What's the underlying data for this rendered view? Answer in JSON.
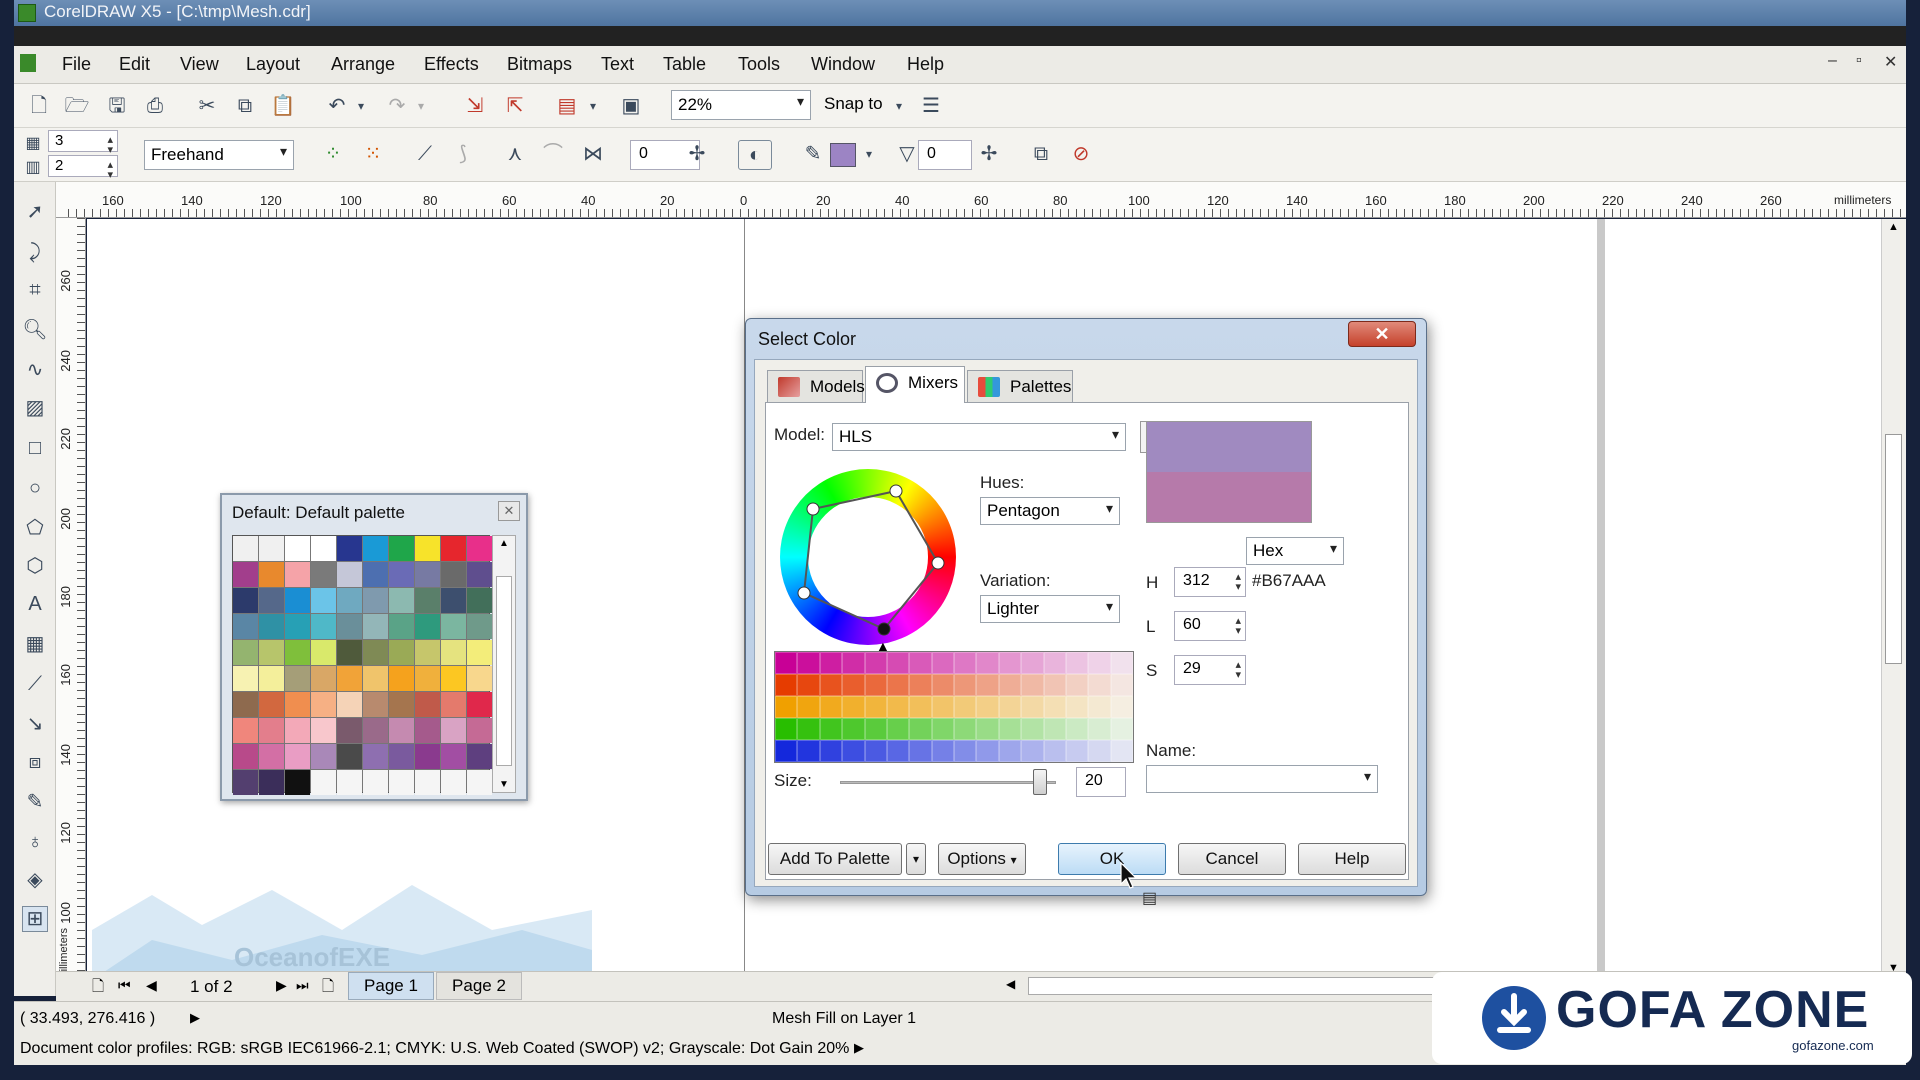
{
  "window": {
    "title": "CorelDRAW X5 - [C:\\tmp\\Mesh.cdr]"
  },
  "menu": [
    "File",
    "Edit",
    "View",
    "Layout",
    "Arrange",
    "Effects",
    "Bitmaps",
    "Text",
    "Table",
    "Tools",
    "Window",
    "Help"
  ],
  "toolbar": {
    "zoom": "22%",
    "snap_to": "Snap to"
  },
  "propbar": {
    "rows": "3",
    "cols": "2",
    "mode": "Freehand",
    "smoothing": "0",
    "transparency": "0"
  },
  "ruler": {
    "units": "millimeters",
    "top_ticks": [
      "160",
      "140",
      "120",
      "100",
      "80",
      "60",
      "40",
      "20",
      "0",
      "20",
      "40",
      "60",
      "80",
      "100",
      "120",
      "140",
      "160",
      "180",
      "200",
      "220",
      "240",
      "260"
    ],
    "left_ticks": [
      "260",
      "240",
      "220",
      "200",
      "180",
      "160",
      "140",
      "120",
      "100"
    ],
    "left_units": "millimeters"
  },
  "palette": {
    "title": "Default: Default palette",
    "colors": [
      "#f0f0f0",
      "#f0f0f0",
      "#ffffff",
      "#ffffff",
      "#27368f",
      "#1a9ad6",
      "#1fa64a",
      "#f7e32a",
      "#e6262d",
      "#e82f8a",
      "#a23e8c",
      "#e8892d",
      "#f5a3a8",
      "#7a7a7a",
      "#c5c7d8",
      "#4d6fb0",
      "#6a6bb6",
      "#777aa3",
      "#6a6a6a",
      "#5f4e8e",
      "#2c3a6b",
      "#55688a",
      "#1a8ed3",
      "#6bc4e8",
      "#6fa9c0",
      "#7f9aae",
      "#8cb9b0",
      "#5a7f6a",
      "#3d4f6e",
      "#426f5a",
      "#5a86a5",
      "#2f91a5",
      "#27a0b5",
      "#4fb8c8",
      "#6a8f9a",
      "#93b6b8",
      "#5aa387",
      "#2e9a7d",
      "#7bb6a0",
      "#6f9a8a",
      "#94b46f",
      "#b7c56b",
      "#7fbf3b",
      "#d9e96b",
      "#4f5a3b",
      "#7f8a55",
      "#9aaa56",
      "#c6c66b",
      "#e5e37f",
      "#f3ed7a",
      "#f7f2b2",
      "#f4ef9b",
      "#a59e78",
      "#d9a766",
      "#f1a338",
      "#f0c46b",
      "#f5a21d",
      "#f0b03c",
      "#fcc722",
      "#f8d78d",
      "#8e6a4e",
      "#d2683f",
      "#f08e4f",
      "#f6b084",
      "#f5d3b7",
      "#b88a6e",
      "#a5754e",
      "#c05a4a",
      "#e47a6c",
      "#e0284b",
      "#f0867c",
      "#e37e8c",
      "#f3a9b8",
      "#f8c7cc",
      "#7a5a6c",
      "#9a6a8a",
      "#c58ab0",
      "#a55a8c",
      "#d9a3c4",
      "#c56a95",
      "#b84a8a",
      "#d36fa5",
      "#e99dc4",
      "#a988b8",
      "#4a4a4a",
      "#8e6fb0",
      "#7a5a9e",
      "#8a3a8e",
      "#a24ea3",
      "#5e3f7f",
      "#533f6f",
      "#3b2e5a",
      "#111111",
      "#f5f5f5",
      "#f5f5f5",
      "#f5f5f5",
      "#f5f5f5",
      "#f5f5f5",
      "#f5f5f5",
      "#f5f5f5"
    ]
  },
  "dialog": {
    "title": "Select Color",
    "tabs": [
      "Models",
      "Mixers",
      "Palettes"
    ],
    "model_label": "Model:",
    "model_value": "HLS",
    "hues_label": "Hues:",
    "hues_value": "Pentagon",
    "variation_label": "Variation:",
    "variation_value": "Lighter",
    "format_value": "Hex",
    "hex_value": "#B67AAA",
    "h_label": "H",
    "h_value": "312",
    "l_label": "L",
    "l_value": "60",
    "s_label": "S",
    "s_value": "29",
    "name_label": "Name:",
    "size_label": "Size:",
    "size_value": "20",
    "buttons": {
      "add": "Add To Palette",
      "options": "Options",
      "ok": "OK",
      "cancel": "Cancel",
      "help": "Help"
    },
    "swatch_top": "#A08AC0",
    "swatch_bottom": "#B67AAA"
  },
  "pagebar": {
    "counter": "1 of 2",
    "pages": [
      "Page 1",
      "Page 2"
    ]
  },
  "status": {
    "coords": "( 33.493, 276.416 )",
    "object": "Mesh Fill on Layer 1",
    "profiles": "Document color profiles: RGB: sRGB IEC61966-2.1; CMYK: U.S. Web Coated (SWOP) v2; Grayscale: Dot Gain 20%"
  },
  "watermark": {
    "text": "OceanofEXE"
  },
  "brand": {
    "name": "GOFA ZONE",
    "url": "gofazone.com"
  }
}
